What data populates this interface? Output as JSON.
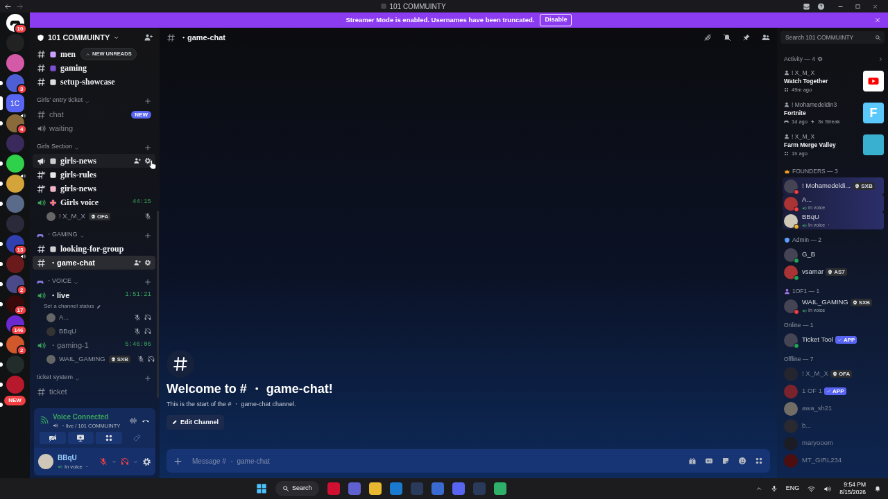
{
  "title_bar": {
    "title": "101 COMMUINTY"
  },
  "banner": {
    "text": "Streamer Mode is enabled. Usernames have been truncated.",
    "button": "Disable"
  },
  "servers": [
    {
      "kind": "home",
      "badge": "10",
      "selected": false,
      "unread": false,
      "voice": false
    },
    {
      "kind": "image",
      "selected": false,
      "unread": false,
      "voice": false
    },
    {
      "kind": "image",
      "selected": false,
      "unread": false,
      "voice": false
    },
    {
      "kind": "image",
      "badge": "3",
      "selected": false,
      "unread": true,
      "voice": false
    },
    {
      "kind": "label",
      "label": "1C",
      "selected": true,
      "unread": false,
      "voice": false
    },
    {
      "kind": "image",
      "badge": "4",
      "selected": false,
      "unread": true,
      "voice": true
    },
    {
      "kind": "image",
      "selected": false,
      "unread": false,
      "voice": false
    },
    {
      "kind": "image",
      "selected": false,
      "unread": true,
      "voice": false
    },
    {
      "kind": "image",
      "selected": false,
      "unread": true,
      "voice": true
    },
    {
      "kind": "image",
      "selected": false,
      "unread": true,
      "voice": false
    },
    {
      "kind": "image",
      "selected": false,
      "unread": false,
      "voice": false
    },
    {
      "kind": "image",
      "badge": "13",
      "selected": false,
      "unread": true,
      "voice": false
    },
    {
      "kind": "image",
      "selected": false,
      "unread": true,
      "voice": true
    },
    {
      "kind": "image",
      "badge": "2",
      "selected": false,
      "unread": true,
      "voice": false
    },
    {
      "kind": "image",
      "badge": "17",
      "selected": false,
      "unread": true,
      "voice": false
    },
    {
      "kind": "image",
      "badge": "146",
      "selected": false,
      "unread": false,
      "voice": false
    },
    {
      "kind": "image",
      "badge": "2",
      "selected": false,
      "unread": true,
      "voice": false
    },
    {
      "kind": "image",
      "selected": false,
      "unread": true,
      "voice": false
    },
    {
      "kind": "image",
      "selected": false,
      "unread": true,
      "voice": false
    },
    {
      "kind": "new",
      "label": "NEW",
      "selected": false,
      "unread": true,
      "voice": false
    }
  ],
  "server_header": {
    "name": "101 COMMUINTY"
  },
  "sections": [
    {
      "channels": [
        {
          "kind": "text",
          "name": "men",
          "pill": "NEW UNREADS",
          "emoji": true,
          "unread": true,
          "selected": false,
          "hovered": false
        },
        {
          "kind": "text",
          "name": "gaming",
          "emoji": true,
          "unread": true,
          "selected": false,
          "hovered": false
        },
        {
          "kind": "text",
          "name": "setup-showcase",
          "emoji": true,
          "unread": true,
          "selected": false,
          "hovered": false
        }
      ]
    },
    {
      "title": "Girls' entry ticket",
      "channels": [
        {
          "kind": "text",
          "name": "chat",
          "badge": "NEW",
          "emoji": false,
          "unread": false,
          "selected": false,
          "hovered": false
        },
        {
          "kind": "voice",
          "name": "waiting",
          "emoji": false,
          "unread": false,
          "selected": false,
          "hovered": false,
          "active": false
        }
      ]
    },
    {
      "title": "Girls Section",
      "channels": [
        {
          "kind": "announcement",
          "name": "girls-news",
          "emoji": true,
          "unread": true,
          "selected": false,
          "hovered": true
        },
        {
          "kind": "thread",
          "name": "girls-rules",
          "emoji": true,
          "unread": true,
          "selected": false,
          "hovered": false
        },
        {
          "kind": "thread",
          "name": "girls-news",
          "emoji": true,
          "unread": true,
          "selected": false,
          "hovered": false
        },
        {
          "kind": "voice",
          "name": "Girls voice",
          "emoji": true,
          "unread": true,
          "selected": false,
          "hovered": false,
          "active": true,
          "timer": "44:15",
          "children": [
            {
              "name": "! X‿M‿X",
              "tag": "OFA",
              "muted": true,
              "deafened": false
            }
          ]
        }
      ]
    },
    {
      "title": "・GAMING",
      "icon": true,
      "channels": [
        {
          "kind": "text",
          "name": "looking-for-group",
          "emoji": true,
          "unread": true,
          "selected": false,
          "hovered": false
        },
        {
          "kind": "text",
          "name": "・game-chat",
          "emoji": false,
          "unread": true,
          "selected": true,
          "hovered": false
        }
      ]
    },
    {
      "title": "・VOICE",
      "icon": true,
      "channels": [
        {
          "kind": "voice",
          "name": "・live",
          "emoji": false,
          "unread": true,
          "selected": false,
          "hovered": false,
          "active": true,
          "timer": "1:51:21",
          "status": "Set a channel status",
          "children": [
            {
              "name": "A...",
              "muted": true,
              "deafened": true
            },
            {
              "name": "BBqU",
              "muted": true,
              "deafened": true
            }
          ]
        },
        {
          "kind": "voice",
          "name": "・gaming-1",
          "emoji": false,
          "unread": false,
          "selected": false,
          "hovered": false,
          "active": true,
          "timer": "5:46:06",
          "children": [
            {
              "name": "WAIL_GAMING",
              "tag": "SXB",
              "muted": true,
              "deafened": true
            }
          ]
        }
      ]
    },
    {
      "title": "ticket system",
      "channels": [
        {
          "kind": "text",
          "name": "ticket",
          "emoji": false,
          "unread": false,
          "selected": false,
          "hovered": false
        }
      ]
    }
  ],
  "voice_panel": {
    "title": "Voice Connected",
    "location": "・live / 101 COMMUINTY"
  },
  "user_panel": {
    "name": "BBqU",
    "status": "In voice ・",
    "mic_muted": true,
    "deafened": true
  },
  "main": {
    "channel": "・game-chat",
    "welcome_title": "Welcome to # ・ game-chat!",
    "welcome_text": "This is the start of the # ・ game-chat channel.",
    "edit_button": "Edit Channel",
    "message_placeholder": "Message # ・ game-chat"
  },
  "search": {
    "placeholder": "Search 101 COMMUINTY"
  },
  "activity": {
    "title": "Activity — 4",
    "items": [
      {
        "user": "! X‿M‿X",
        "title": "Watch Together",
        "meta": [
          "49m ago"
        ],
        "kind": "youtube"
      },
      {
        "user": "! Mohamedeldin3",
        "title": "Fortnite",
        "meta": [
          "1d ago",
          "3x Streak"
        ],
        "kind": "letter",
        "tile_text": "F"
      },
      {
        "user": "! X‿M‿X",
        "title": "Farm Merge Valley",
        "meta": [
          "1h ago"
        ],
        "kind": "image"
      }
    ]
  },
  "member_groups": [
    {
      "title": "FOUNDERS — 3",
      "members": [
        {
          "name": "! Mohamedeldi...",
          "tag": "SXB",
          "color": "#f23f43",
          "offline": false,
          "banner": true
        },
        {
          "name": "A...",
          "sub": "In voice",
          "color": "#f23f43",
          "offline": false,
          "banner": true
        },
        {
          "name": "BBqU",
          "sub": "In voice ・",
          "color": "#f0b232",
          "offline": false,
          "banner": true
        }
      ]
    },
    {
      "title": "Admin — 2",
      "members": [
        {
          "name": "G_B",
          "color": "#23a55a",
          "offline": false,
          "banner": false
        },
        {
          "name": "vsamar",
          "tag": "AS7",
          "color": "#23a55a",
          "offline": false,
          "banner": false
        }
      ]
    },
    {
      "title": "1OF1 — 1",
      "members": [
        {
          "name": "WAIL_GAMING",
          "tag": "SXB",
          "sub": "In voice",
          "color": "#f23f43",
          "offline": false,
          "banner": false
        }
      ]
    },
    {
      "title": "Online — 1",
      "members": [
        {
          "name": "Ticket Tool",
          "app": "APP",
          "color": "#23a55a",
          "offline": false,
          "banner": false
        }
      ]
    },
    {
      "title": "Offline — 7",
      "members": [
        {
          "name": "! X‿M‿X",
          "tag": "OFA",
          "offline": true,
          "banner": false
        },
        {
          "name": "1 OF 1",
          "app": "APP",
          "offline": true,
          "banner": false
        },
        {
          "name": "awa_sh21",
          "offline": true,
          "banner": false
        },
        {
          "name": "b...",
          "offline": true,
          "banner": false
        },
        {
          "name": "maryooom",
          "offline": true,
          "banner": false
        },
        {
          "name": "MT_GIRL234",
          "offline": true,
          "banner": false
        }
      ]
    }
  ],
  "taskbar": {
    "search": "Search",
    "language": "ENG",
    "time": "9:54 PM",
    "date": "8/15/2026"
  }
}
